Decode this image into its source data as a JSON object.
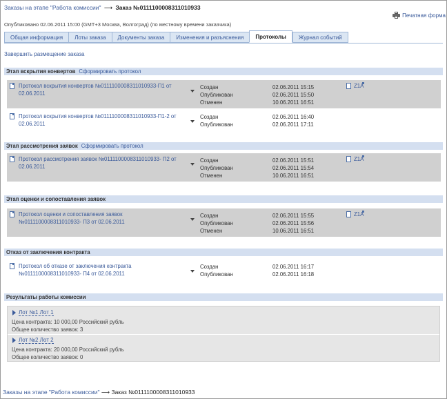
{
  "breadcrumb": {
    "parent": "Заказы на этапе \"Работа комиссии\"",
    "arrow": "⟶",
    "current": "Заказ №0111100008311010933"
  },
  "print_label": "Печатная форма",
  "published": "Опубликовано 02.06.2011 15:00 (GMT+3 Москва, Волгоград) (по местному времени заказчика)",
  "tabs": [
    {
      "label": "Общая информация"
    },
    {
      "label": "Лоты заказа"
    },
    {
      "label": "Документы заказа"
    },
    {
      "label": "Изменения и разъяснения"
    },
    {
      "label": "Протоколы"
    },
    {
      "label": "Журнал событий"
    }
  ],
  "active_tab": "Протоколы",
  "finish_link": "Завершить размещение заказа",
  "sections": {
    "opening": {
      "title": "Этап вскрытия конвертов",
      "action": "Сформировать протокол",
      "records": [
        {
          "title": "Протокол вскрытия конвертов №0111100008311010933-П1 от 02.06.2011",
          "statuses": [
            {
              "label": "Создан",
              "date": "02.06.2011 15:15"
            },
            {
              "label": "Опубликован",
              "date": "02.06.2011 15:50"
            },
            {
              "label": "Отменен",
              "date": "10.06.2011 16:51"
            }
          ],
          "attachment": "Z1A"
        },
        {
          "title": "Протокол вскрытия конвертов №0111100008311010933-П1-2 от 02.06.2011",
          "statuses": [
            {
              "label": "Создан",
              "date": "02.06.2011 16:40"
            },
            {
              "label": "Опубликован",
              "date": "02.06.2011 17:11"
            }
          ]
        }
      ]
    },
    "review": {
      "title": "Этап рассмотрения заявок",
      "action": "Сформировать протокол",
      "records": [
        {
          "title": "Протокол рассмотрения заявок №0111100008311010933- П2 от 02.06.2011",
          "statuses": [
            {
              "label": "Создан",
              "date": "02.06.2011 15:51"
            },
            {
              "label": "Опубликован",
              "date": "02.06.2011 15:54"
            },
            {
              "label": "Отменен",
              "date": "10.06.2011 16:51"
            }
          ],
          "attachment": "Z1A"
        }
      ]
    },
    "evaluation": {
      "title": "Этап оценки и сопоставления заявок",
      "records": [
        {
          "title": "Протокол оценки и сопоставления заявок №0111100008311010933- П3 от 02.06.2011",
          "statuses": [
            {
              "label": "Создан",
              "date": "02.06.2011 15:55"
            },
            {
              "label": "Опубликован",
              "date": "02.06.2011 15:56"
            },
            {
              "label": "Отменен",
              "date": "10.06.2011 16:51"
            }
          ],
          "attachment": "Z1A"
        }
      ]
    },
    "refusal": {
      "title": "Отказ от заключения контракта",
      "records": [
        {
          "title": "Протокол об отказе от заключения контракта №0111100008311010933- П4 от 02.06.2011",
          "statuses": [
            {
              "label": "Создан",
              "date": "02.06.2011 16:17"
            },
            {
              "label": "Опубликован",
              "date": "02.06.2011 16:18"
            }
          ]
        }
      ]
    },
    "results": {
      "title": "Результаты работы комиссии",
      "lots": [
        {
          "label": "Лот №1 Лот 1",
          "price": "Цена контракта: 10 000,00  Российский рубль",
          "count": "Общее количество заявок: 3"
        },
        {
          "label": "Лот №2 Лот 2",
          "price": "Цена контракта: 20 000,00  Российский рубль",
          "count": "Общее количество заявок: 0"
        }
      ]
    }
  },
  "colors": {
    "link": "#3a5a9a",
    "section_header": "#d4dff0",
    "record_grey": "#d0d0d0",
    "tab_bg": "#dbe6f3"
  }
}
